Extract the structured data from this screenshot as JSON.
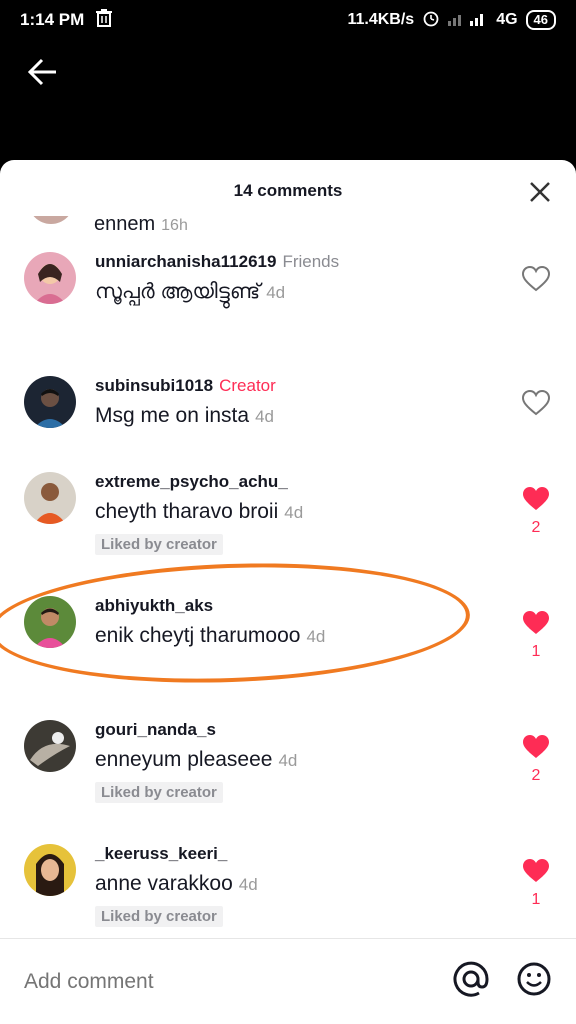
{
  "status_bar": {
    "time": "1:14 PM",
    "speed": "11.4KB/s",
    "network": "4G",
    "battery": "46"
  },
  "sheet": {
    "title": "14 comments",
    "partial": {
      "text": "ennem",
      "time": "16h"
    },
    "comments": [
      {
        "user": "unniarchanisha112619",
        "tag": "Friends",
        "tag_type": "friends",
        "text": "സൂപ്പർ ആയിട്ടുണ്ട്",
        "time": "4d",
        "liked": false,
        "likes": "",
        "liked_by_creator": ""
      },
      {
        "user": "subinsubi1018",
        "tag": "Creator",
        "tag_type": "creator",
        "text": "Msg me on insta",
        "time": "4d",
        "liked": false,
        "likes": "",
        "liked_by_creator": ""
      },
      {
        "user": "extreme_psycho_achu_",
        "tag": "",
        "tag_type": "",
        "text": "cheyth tharavo broii",
        "time": "4d",
        "liked": true,
        "likes": "2",
        "liked_by_creator": "Liked by creator"
      },
      {
        "user": "abhiyukth_aks",
        "tag": "",
        "tag_type": "",
        "text": "enik cheytj tharumooo",
        "time": "4d",
        "liked": true,
        "likes": "1",
        "liked_by_creator": ""
      },
      {
        "user": "gouri_nanda_s",
        "tag": "",
        "tag_type": "",
        "text": "enneyum pleaseee",
        "time": "4d",
        "liked": true,
        "likes": "2",
        "liked_by_creator": "Liked by creator"
      },
      {
        "user": "_keeruss_keeri_",
        "tag": "",
        "tag_type": "",
        "text": "anne varakkoo",
        "time": "4d",
        "liked": true,
        "likes": "1",
        "liked_by_creator": "Liked by creator"
      }
    ]
  },
  "footer": {
    "placeholder": "Add comment"
  },
  "colors": {
    "accent": "#fe2c55",
    "highlight": "#f07a21"
  }
}
